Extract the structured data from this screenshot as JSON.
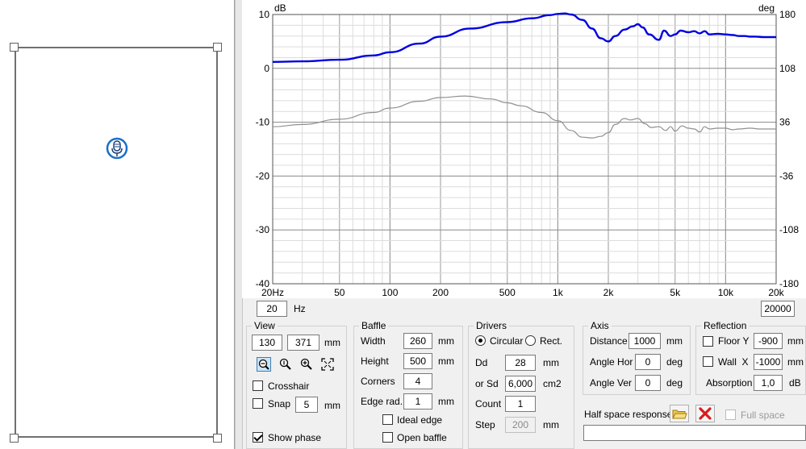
{
  "chart_data": {
    "type": "line",
    "ylabel_left": "dB",
    "ylabel_right": "deg",
    "xscale": "log",
    "xlim": [
      20,
      20000
    ],
    "ylim": [
      -40,
      10
    ],
    "y2lim": [
      -180,
      180
    ],
    "x_tick_labels": [
      {
        "v": 20,
        "t": "20Hz"
      },
      {
        "v": 50,
        "t": "50"
      },
      {
        "v": 100,
        "t": "100"
      },
      {
        "v": 200,
        "t": "200"
      },
      {
        "v": 500,
        "t": "500"
      },
      {
        "v": 1000,
        "t": "1k"
      },
      {
        "v": 2000,
        "t": "2k"
      },
      {
        "v": 5000,
        "t": "5k"
      },
      {
        "v": 10000,
        "t": "10k"
      },
      {
        "v": 20000,
        "t": "20k"
      }
    ],
    "y_tick_labels": [
      10,
      0,
      -10,
      -20,
      -30,
      -40
    ],
    "y2_tick_labels": [
      180,
      108,
      36,
      -36,
      -108,
      -180
    ],
    "grid": true,
    "series": [
      {
        "color": "#0000e0",
        "axis": "left",
        "x": [
          20,
          30,
          50,
          80,
          100,
          150,
          200,
          300,
          500,
          700,
          900,
          1000,
          1100,
          1200,
          1400,
          1600,
          1800,
          2000,
          2200,
          2500,
          2800,
          3000,
          3200,
          3500,
          4000,
          4300,
          4700,
          5000,
          5400,
          6000,
          6500,
          7000,
          7500,
          8000,
          9000,
          10000,
          11000,
          12000,
          13000,
          14000,
          15000,
          17000,
          20000
        ],
        "y": [
          1.2,
          1.3,
          1.6,
          2.4,
          3.0,
          4.6,
          5.9,
          7.4,
          8.6,
          9.3,
          9.9,
          10.1,
          10.2,
          10.0,
          9.0,
          7.4,
          5.6,
          5.0,
          6.0,
          7.2,
          7.8,
          8.2,
          7.6,
          6.3,
          5.3,
          7.0,
          6.0,
          6.3,
          7.0,
          6.7,
          6.9,
          6.5,
          6.9,
          6.3,
          6.4,
          6.3,
          6.2,
          6.0,
          6.0,
          5.9,
          5.9,
          5.8,
          5.8
        ]
      },
      {
        "color": "#909090",
        "axis": "right",
        "x": [
          20,
          30,
          50,
          80,
          100,
          150,
          200,
          280,
          400,
          500,
          600,
          800,
          1000,
          1200,
          1400,
          1600,
          1800,
          2000,
          2200,
          2500,
          2700,
          3000,
          3300,
          3600,
          4000,
          4400,
          4700,
          5000,
          5500,
          6000,
          6500,
          7000,
          7500,
          8000,
          9000,
          10000,
          11000,
          12000,
          14000,
          16000,
          20000
        ],
        "y": [
          30,
          33,
          40,
          49,
          55,
          64,
          69,
          71,
          67,
          62,
          58,
          49,
          38,
          25,
          16,
          15,
          17,
          22,
          33,
          41,
          39,
          41,
          34,
          29,
          30,
          25,
          30,
          24,
          31,
          28,
          27,
          23,
          30,
          27,
          28,
          28,
          26,
          27,
          28,
          27,
          27
        ]
      }
    ]
  },
  "freq_min": {
    "value": "20",
    "unit": "Hz"
  },
  "freq_max": {
    "value": "20000"
  },
  "view": {
    "title": "View",
    "w": "130",
    "h": "371",
    "unit": "mm",
    "crosshair_label": "Crosshair",
    "crosshair": false,
    "snap_label": "Snap",
    "snap_value": "5",
    "snap_unit": "mm",
    "snap": false,
    "show_phase_label": "Show phase",
    "show_phase": true
  },
  "baffle": {
    "title": "Baffle",
    "width_label": "Width",
    "width": "260",
    "height_label": "Height",
    "height": "500",
    "corners_label": "Corners",
    "corners": "4",
    "edge_label": "Edge rad.",
    "edge": "1",
    "unit": "mm",
    "ideal_edge_label": "Ideal edge",
    "open_baffle_label": "Open baffle"
  },
  "drivers": {
    "title": "Drivers",
    "circular_label": "Circular",
    "rect_label": "Rect.",
    "dd_label": "Dd",
    "dd": "28",
    "dd_unit": "mm",
    "sd_label": "or Sd",
    "sd": "6,000",
    "sd_unit": "cm2",
    "count_label": "Count",
    "count": "1",
    "step_label": "Step",
    "step": "200",
    "step_unit": "mm"
  },
  "axis": {
    "title": "Axis",
    "distance_label": "Distance",
    "distance": "1000",
    "distance_unit": "mm",
    "hor_label": "Angle Hor",
    "hor": "0",
    "ver_label": "Angle Ver",
    "ver": "0",
    "deg": "deg"
  },
  "reflection": {
    "title": "Reflection",
    "floor_label": "Floor Y",
    "floor": "-900",
    "floor_unit": "mm",
    "wall_label": "Wall  X",
    "wall": "-1000",
    "wall_unit": "mm",
    "absorption_label": "Absorption",
    "absorption": "1,0",
    "absorption_unit": "dB"
  },
  "half_space": {
    "label": "Half space response",
    "full_space_label": "Full space"
  },
  "colors": {
    "spl": "#0000e0",
    "phase": "#909090",
    "mic": "#1a6fc8"
  }
}
